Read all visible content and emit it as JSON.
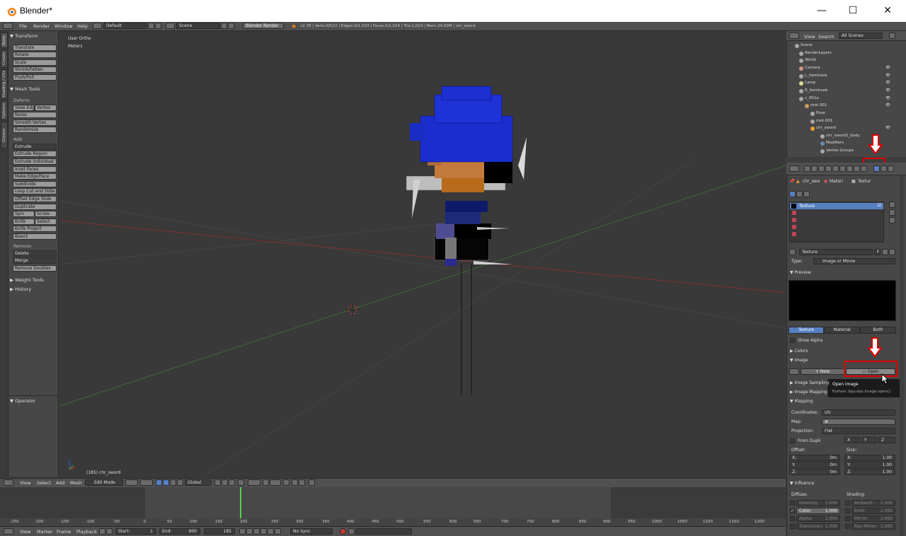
{
  "window": {
    "title": "Blender*",
    "minimize": "—",
    "maximize": "☐",
    "close": "✕"
  },
  "info_header": {
    "menus": [
      "File",
      "Render",
      "Window",
      "Help"
    ],
    "screen_layout": "Default",
    "scene": "Scene",
    "render_engine": "Blender Render",
    "stats": "v2.78 | Verts:0/522 | Edges:0/1,533 | Faces:0/1,024 | Tris:1,024 | Mem:24.00M | chr_sword"
  },
  "left_tabs": [
    "Tools",
    "Create",
    "Shading / UVs",
    "Options",
    "Grease Pencil"
  ],
  "toolshelf": {
    "transform": {
      "title": "Transform",
      "buttons": [
        "Translate",
        "Rotate",
        "Scale",
        "Shrink/Fatten",
        "Push/Pull"
      ]
    },
    "mesh_tools": {
      "title": "Mesh Tools",
      "deform_label": "Deform:",
      "slide_edge": "Slide Edge",
      "vertex": "Vertex",
      "deform_buttons": [
        "Noise",
        "Smooth Vertex",
        "Randomize"
      ],
      "add_label": "Add:",
      "extrude": "Extrude",
      "add_buttons": [
        "Extrude Region",
        "Extrude Individual",
        "Inset Faces",
        "Make Edge/Face",
        "Subdivide",
        "Loop Cut and Slide",
        "Offset Edge Slide",
        "Duplicate"
      ],
      "spin": "Spin",
      "screw": "Screw",
      "knife": "Knife",
      "select": "Select",
      "more_buttons": [
        "Knife Project",
        "Bisect"
      ],
      "remove_label": "Remove:",
      "delete": "Delete",
      "merge": "Merge",
      "remove_doubles": "Remove Doubles"
    },
    "weight_tools": "Weight Tools",
    "history": "History",
    "operator": "Operator"
  },
  "viewport": {
    "view_name": "User Ortho",
    "units": "Meters",
    "object_info": "(185) chr_sword"
  },
  "view3d_header": {
    "menus": [
      "View",
      "Select",
      "Add",
      "Mesh"
    ],
    "mode": "Edit Mode",
    "orientation": "Global"
  },
  "timeline": {
    "ticks": [
      "-250",
      "-200",
      "-150",
      "-100",
      "-50",
      "0",
      "50",
      "100",
      "150",
      "200",
      "250",
      "300",
      "350",
      "400",
      "450",
      "500",
      "550",
      "600",
      "650",
      "700",
      "750",
      "800",
      "850",
      "900",
      "950",
      "1000",
      "1050",
      "1100",
      "1150",
      "1200"
    ],
    "current_frame": 185,
    "menus": [
      "View",
      "Marker",
      "Frame",
      "Playback"
    ],
    "start_label": "Start:",
    "start": "1",
    "end_label": "End:",
    "end": "900",
    "frame": "185",
    "sync": "No Sync"
  },
  "outliner": {
    "menus": [
      "View",
      "Search"
    ],
    "filter": "All Scenes",
    "rows": [
      "Scene",
      "RenderLayers",
      "World",
      "Camera",
      "L_itemhook",
      "Lamp",
      "R_itemhook",
      "c_001a",
      "root.001",
      "Pose",
      "root.001",
      "chr_sword",
      "chr_sword2_body",
      "Modifiers",
      "Vertex Groups"
    ]
  },
  "properties": {
    "breadcrumb": [
      "chr_swo",
      "Materi",
      "Textur"
    ],
    "texture_slot_name": "Texture",
    "texture_name": "Texture",
    "texture_name_suffix": "F",
    "type_label": "Type:",
    "type_value": "Image or Movie",
    "preview_title": "Preview",
    "preview_tabs": [
      "Texture",
      "Material",
      "Both"
    ],
    "show_alpha": "Show Alpha",
    "colors_title": "Colors",
    "image_title": "Image",
    "new_button": "New",
    "open_button": "Open",
    "tooltip_title": "Open image",
    "tooltip_python": "Python: bpy.ops.image.open()",
    "image_sampling": "Image Sampling",
    "image_mapping": "Image Mapping",
    "mapping_title": "Mapping",
    "coordinates_label": "Coordinates:",
    "coordinates_value": "UV",
    "map_label": "Map:",
    "projection_label": "Projection:",
    "projection_value": "Flat",
    "from_dupli": "From Dupli",
    "xyz": [
      "X",
      "Y",
      "Z"
    ],
    "offset_label": "Offset:",
    "size_label": "Size:",
    "offset": [
      {
        "axis": "X:",
        "value": "0m"
      },
      {
        "axis": "Y:",
        "value": "0m"
      },
      {
        "axis": "Z:",
        "value": "0m"
      }
    ],
    "size": [
      {
        "axis": "X:",
        "value": "1.00"
      },
      {
        "axis": "Y:",
        "value": "1.00"
      },
      {
        "axis": "Z:",
        "value": "1.00"
      }
    ],
    "influence_title": "Influence",
    "diffuse_label": "Diffuse:",
    "shading_label": "Shading:",
    "diffuse": [
      {
        "name": "Intensity",
        "value": "1.000"
      },
      {
        "name": "Color:",
        "value": "1.000"
      },
      {
        "name": "Alpha:",
        "value": "1.000"
      },
      {
        "name": "Translucen:",
        "value": "1.000"
      }
    ],
    "shading": [
      {
        "name": "Ambient:",
        "value": "1.000"
      },
      {
        "name": "Emit:",
        "value": "1.000"
      },
      {
        "name": "Mirror:",
        "value": "1.000"
      },
      {
        "name": "Ray Mirror:",
        "value": "1.000"
      }
    ]
  },
  "colors": {
    "accent_blue": "#5680c2",
    "annotation_red": "#e00000",
    "frame_line": "#4fd34f"
  }
}
